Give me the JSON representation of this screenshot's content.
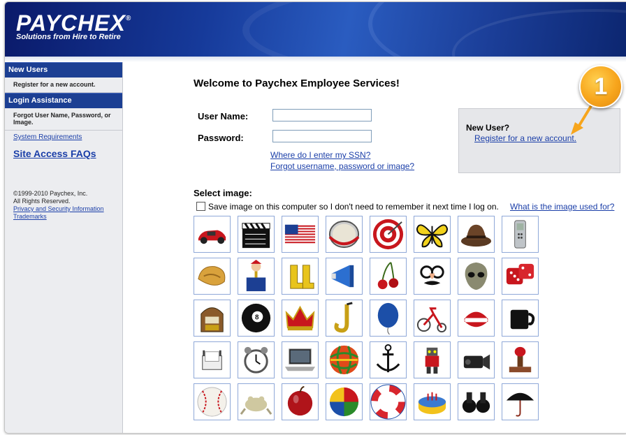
{
  "header": {
    "logo": "PAYCHEX",
    "logo_mark": "®",
    "tagline": "Solutions from Hire to Retire"
  },
  "sidebar": {
    "new_users_heading": "New Users",
    "register_text": "Register for a new account.",
    "login_assistance_heading": "Login Assistance",
    "forgot_text": "Forgot User Name, Password, or Image.",
    "system_requirements": "System Requirements",
    "site_access_faqs": "Site Access FAQs",
    "copyright_line1": "©1999-2010 Paychex, Inc.",
    "copyright_line2": "All Rights Reserved.",
    "privacy_link": "Privacy and Security Information",
    "trademarks_link": "Trademarks"
  },
  "login": {
    "welcome": "Welcome to Paychex Employee Services!",
    "username_label": "User Name:",
    "username_value": "",
    "password_label": "Password:",
    "password_value": "",
    "ssn_link": "Where do I enter my SSN?",
    "forgot_link": "Forgot username, password or image?"
  },
  "new_user": {
    "title": "New User?",
    "register_link": "Register for a new account."
  },
  "callout": {
    "number": "1",
    "color": "#f7a51c"
  },
  "image_select": {
    "title": "Select image:",
    "save_label": "Save image on this computer so I don't need to remember it next time I log on.",
    "save_checked": false,
    "what_link": "What is the image used for?",
    "rows": [
      [
        "red-car-icon",
        "clapperboard-icon",
        "us-flag-icon",
        "drum-icon",
        "target-icon",
        "butterfly-icon",
        "fedora-hat-icon",
        "cell-phone-icon"
      ],
      [
        "fortune-cookie-icon",
        "jack-in-the-box-icon",
        "rain-boots-icon",
        "megaphone-icon",
        "cherries-icon",
        "disguise-glasses-icon",
        "alien-mask-icon",
        "dice-icon"
      ],
      [
        "jukebox-icon",
        "eight-ball-icon",
        "crown-icon",
        "saxophone-icon",
        "balloon-icon",
        "tricycle-icon",
        "chattering-teeth-icon",
        "coffee-mug-icon"
      ],
      [
        "rolodex-icon",
        "alarm-clock-icon",
        "laptop-icon",
        "rubber-band-ball-icon",
        "anchor-icon",
        "toy-robot-icon",
        "camcorder-icon",
        "rubber-stamp-icon"
      ],
      [
        "baseball-icon",
        "frog-icon",
        "apple-icon",
        "beach-ball-icon",
        "life-preserver-icon",
        "birthday-cake-icon",
        "binoculars-icon",
        "umbrella-icon"
      ]
    ]
  }
}
